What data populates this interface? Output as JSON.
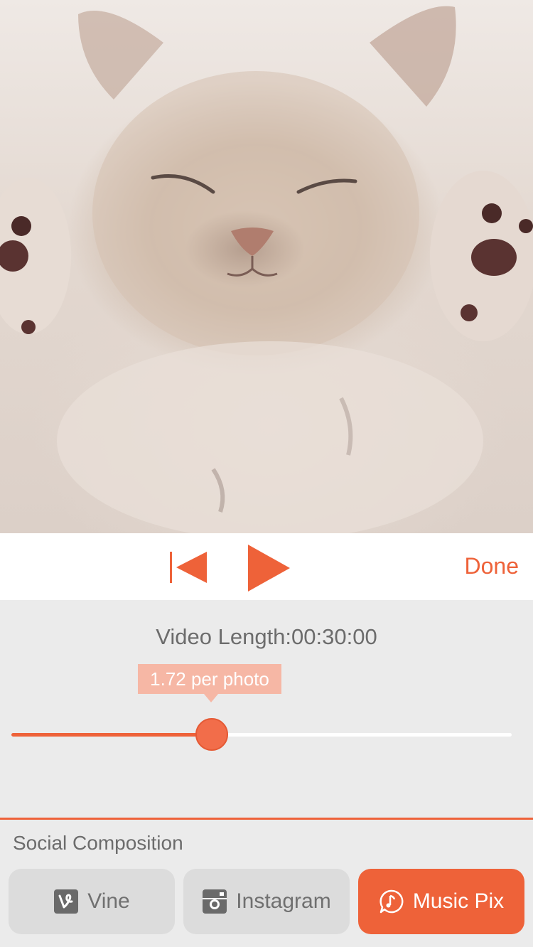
{
  "photo": {
    "subject": "sleeping-kitten-photo"
  },
  "player": {
    "rewind_icon": "skip-to-start-icon",
    "play_icon": "play-icon",
    "done_label": "Done"
  },
  "settings": {
    "video_length_text": "Video Length:00:30:00",
    "per_photo_text": "1.72 per photo",
    "slider_value_fraction": 0.4
  },
  "social": {
    "section_title": "Social Composition",
    "options": [
      {
        "label": "Vine",
        "icon": "vine-icon",
        "selected": false
      },
      {
        "label": "Instagram",
        "icon": "instagram-icon",
        "selected": false
      },
      {
        "label": "Music Pix",
        "icon": "music-note-icon",
        "selected": true
      }
    ]
  },
  "colors": {
    "accent": "#ee6239",
    "tooltip_bg": "#f6b7a5",
    "panel_bg": "#ebebeb",
    "button_inactive": "#dcdcdc"
  }
}
